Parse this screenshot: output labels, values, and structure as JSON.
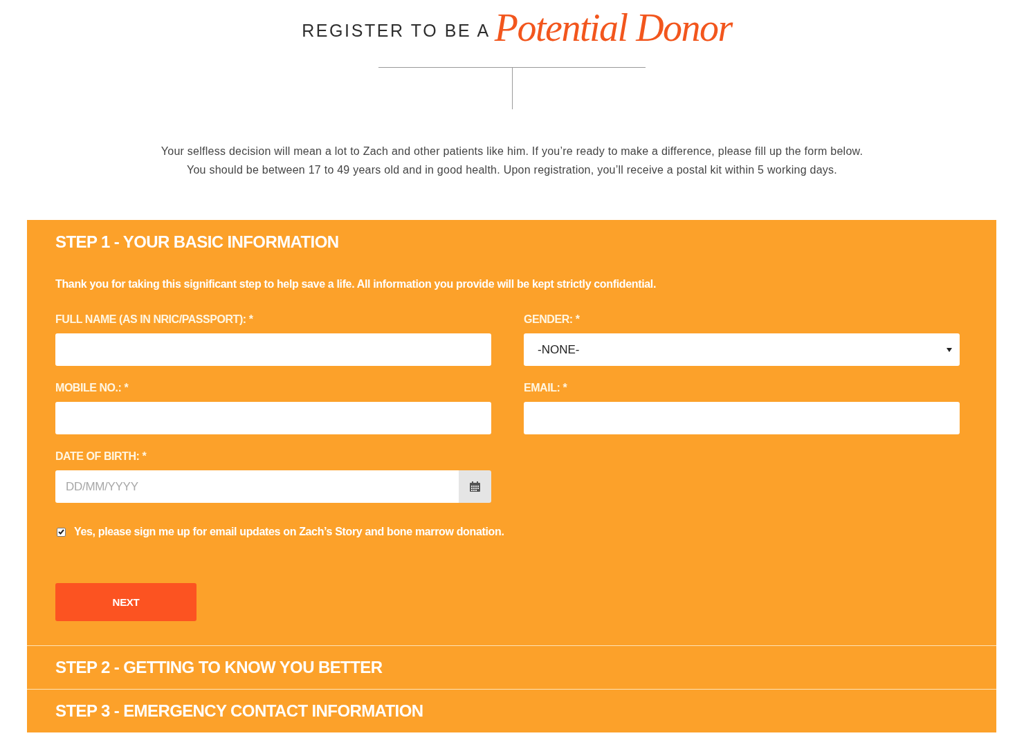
{
  "header": {
    "prefix": "REGISTER TO BE A",
    "script": "Potential Donor"
  },
  "intro": [
    "Your selfless decision will mean a lot to Zach and other patients like him. If you’re ready to make a difference, please fill up the form below.",
    "You should be between 17 to 49 years old and in good health. Upon registration, you’ll receive a postal kit within 5 working days."
  ],
  "steps": [
    {
      "title": "STEP 1 - YOUR BASIC INFORMATION",
      "expanded": true,
      "note": "Thank you for taking this significant step to help save a life. All information you provide will be kept strictly confidential.",
      "fields": [
        {
          "kind": "text",
          "label": "FULL NAME (AS IN NRIC/PASSPORT): *"
        },
        {
          "kind": "select",
          "label": "GENDER: *",
          "value": "-NONE-"
        },
        {
          "kind": "text",
          "label": "MOBILE NO.: *"
        },
        {
          "kind": "text",
          "label": "EMAIL: *"
        },
        {
          "kind": "date",
          "label": "DATE OF BIRTH: *",
          "placeholder": "DD/MM/YYYY"
        }
      ],
      "consent": {
        "label": "Yes, please sign me up for email updates on Zach’s Story and bone marrow donation.",
        "checked": true
      },
      "button": "NEXT"
    },
    {
      "title": "STEP 2 - GETTING TO KNOW YOU BETTER",
      "expanded": false
    },
    {
      "title": "STEP 3 - EMERGENCY CONTACT INFORMATION",
      "expanded": false
    }
  ]
}
